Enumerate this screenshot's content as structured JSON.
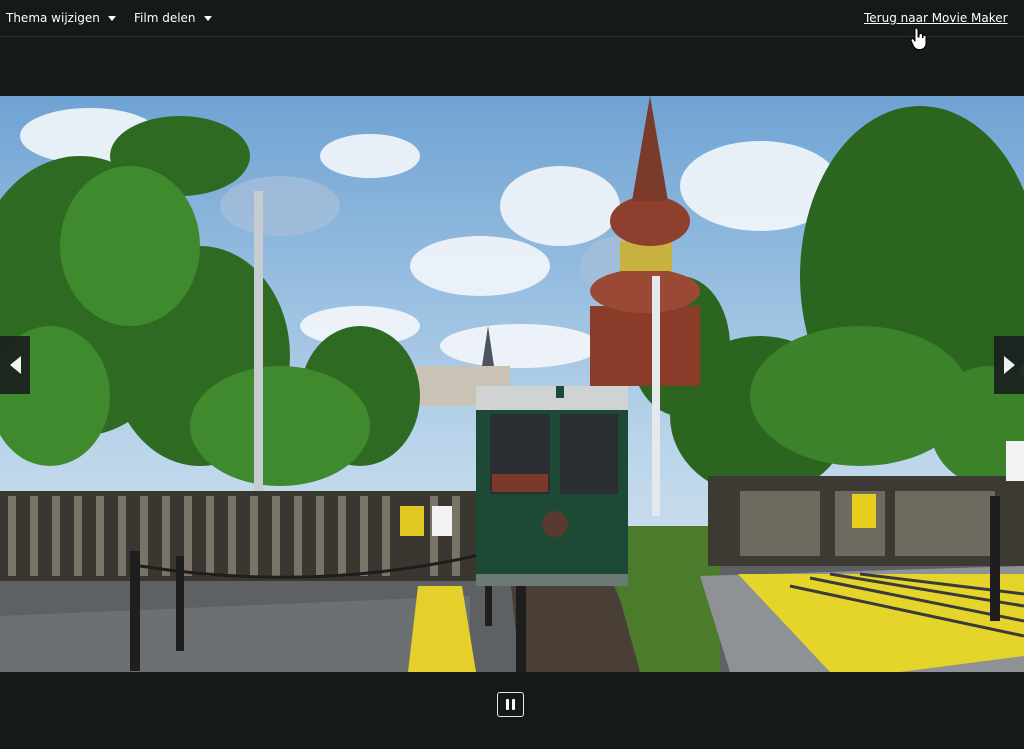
{
  "toolbar": {
    "theme_menu_label": "Thema wijzigen",
    "share_menu_label": "Film delen",
    "back_link_label": "Terug naar Movie Maker"
  },
  "player": {
    "state": "playing",
    "prev_icon": "chevron-left-icon",
    "next_icon": "chevron-right-icon",
    "pause_icon": "pause-icon"
  },
  "colors": {
    "background": "#141a19",
    "text": "#ffffff"
  }
}
